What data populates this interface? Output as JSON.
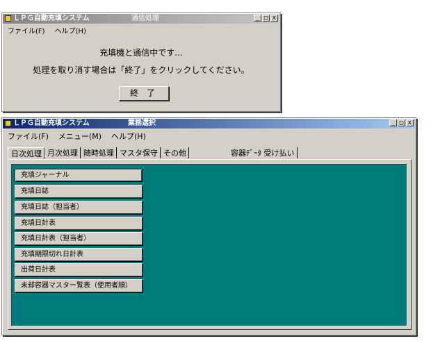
{
  "comm_window": {
    "app_title": "ＬＰＧ自動充填システム",
    "subtitle": "通信処理",
    "menu": [
      "ファイル(F)",
      "ヘルプ(H)"
    ],
    "message1": "充填機と通信中です...",
    "message2": "処理を取り消す場合は「終了」をクリックしてください。",
    "end_button": "終 了"
  },
  "main_window": {
    "app_title": "ＬＰＧ自動充填システム",
    "subtitle": "業務選択",
    "menu": [
      "ファイル(F)",
      "メニュー(M)",
      "ヘルプ(H)"
    ],
    "tabs": [
      "日次処理",
      "月次処理",
      "随時処理",
      "マスタ保守",
      "その他",
      "容器ﾃﾞｰﾀ 受け払い"
    ],
    "active_tab": "日次処理",
    "reports": [
      "充填ジャーナル",
      "充填日誌",
      "充填日誌（担当者）",
      "充填日計表",
      "充填日計表（担当者）",
      "充填期限切れ日計表",
      "出荷日計表",
      "未却容器マスター覧表（使用者順）"
    ],
    "panel_color": "#007b7b"
  },
  "window_controls": {
    "minimize": "_",
    "maximize": "□",
    "close": "x"
  }
}
